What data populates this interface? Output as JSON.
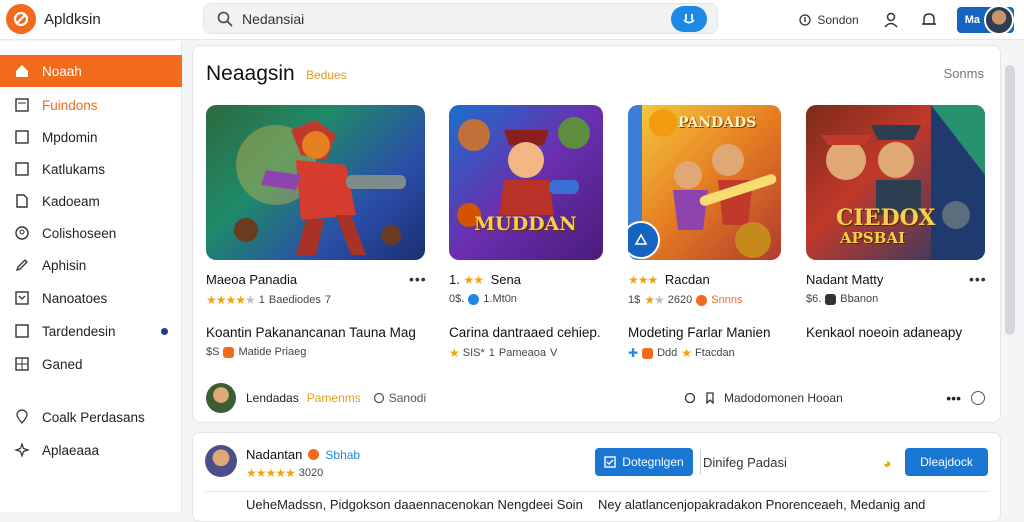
{
  "app": {
    "name": "Apldksin"
  },
  "search": {
    "value": "Nedansiai",
    "placeholder": ""
  },
  "topbar": {
    "status_label": "Sondon",
    "account_label": "Ma"
  },
  "sidebar": {
    "items": [
      {
        "label": "Noaah"
      },
      {
        "label": "Fuindons"
      },
      {
        "label": "Mpdomin"
      },
      {
        "label": "Katlukams"
      },
      {
        "label": "Kadoeam"
      },
      {
        "label": "Colishoseen"
      },
      {
        "label": "Aphisin"
      },
      {
        "label": "Nanoatoes"
      },
      {
        "label": "Tardendesin"
      },
      {
        "label": "Ganed"
      },
      {
        "label": "Coalk Perdasans"
      },
      {
        "label": "Aplaeaaa"
      }
    ]
  },
  "section": {
    "title": "Neaagsin",
    "badge": "Bedues",
    "link": "Sonms"
  },
  "cards": [
    {
      "name": "Maeoa Panadia",
      "rating_count": "1",
      "meta": "Baediodes",
      "meta2": "7",
      "desc": "Koantin Pakanancanan Tauna Mag",
      "price": "$S",
      "sub": "Matide Priaeg"
    },
    {
      "name": "Sena",
      "rating_prefix": "1.",
      "meta": "0$.",
      "meta2": "1.Mt0n",
      "desc": "Carina dantraaed cehiep.",
      "sub": "SIS*",
      "sub_num": "1",
      "sub2": "Pameaoa",
      "sub3": "V"
    },
    {
      "name": "Racdan",
      "rating_prefix": "",
      "meta": "1$",
      "meta2": "2620",
      "meta3": "Snnns",
      "desc": "Modeting Farlar Manien",
      "sub": "Ddd",
      "sub2": "Ftacdan"
    },
    {
      "name": "Nadant Matty",
      "meta": "$6.",
      "meta2": "Bbanon",
      "desc": "Kenkaol noeoin adaneapy"
    }
  ],
  "thumb_texts": {
    "t2": "MUDDAN",
    "t3": "PANDADS",
    "t4a": "CIEDOX",
    "t4b": "APSBAI"
  },
  "footer": {
    "user": "Lendadas",
    "badge": "Pamenms",
    "stat": "Sanodi",
    "right": "Madodomonen Hooan"
  },
  "review": {
    "user": "Nadantan",
    "tag": "Sbhab",
    "rating": "3020",
    "button1": "Dotegnlgen",
    "link": "Dinifeg Padasi",
    "button2": "Dleajdock",
    "text1": "UeheMadssn, Pidgokson daaennacenokan Nengdeei Soin",
    "text2": "Ney alatlancenjopakradakon Pnorenceaeh, Medanig and"
  },
  "colors": {
    "accent": "#f26a1b",
    "primary": "#1976d2"
  }
}
